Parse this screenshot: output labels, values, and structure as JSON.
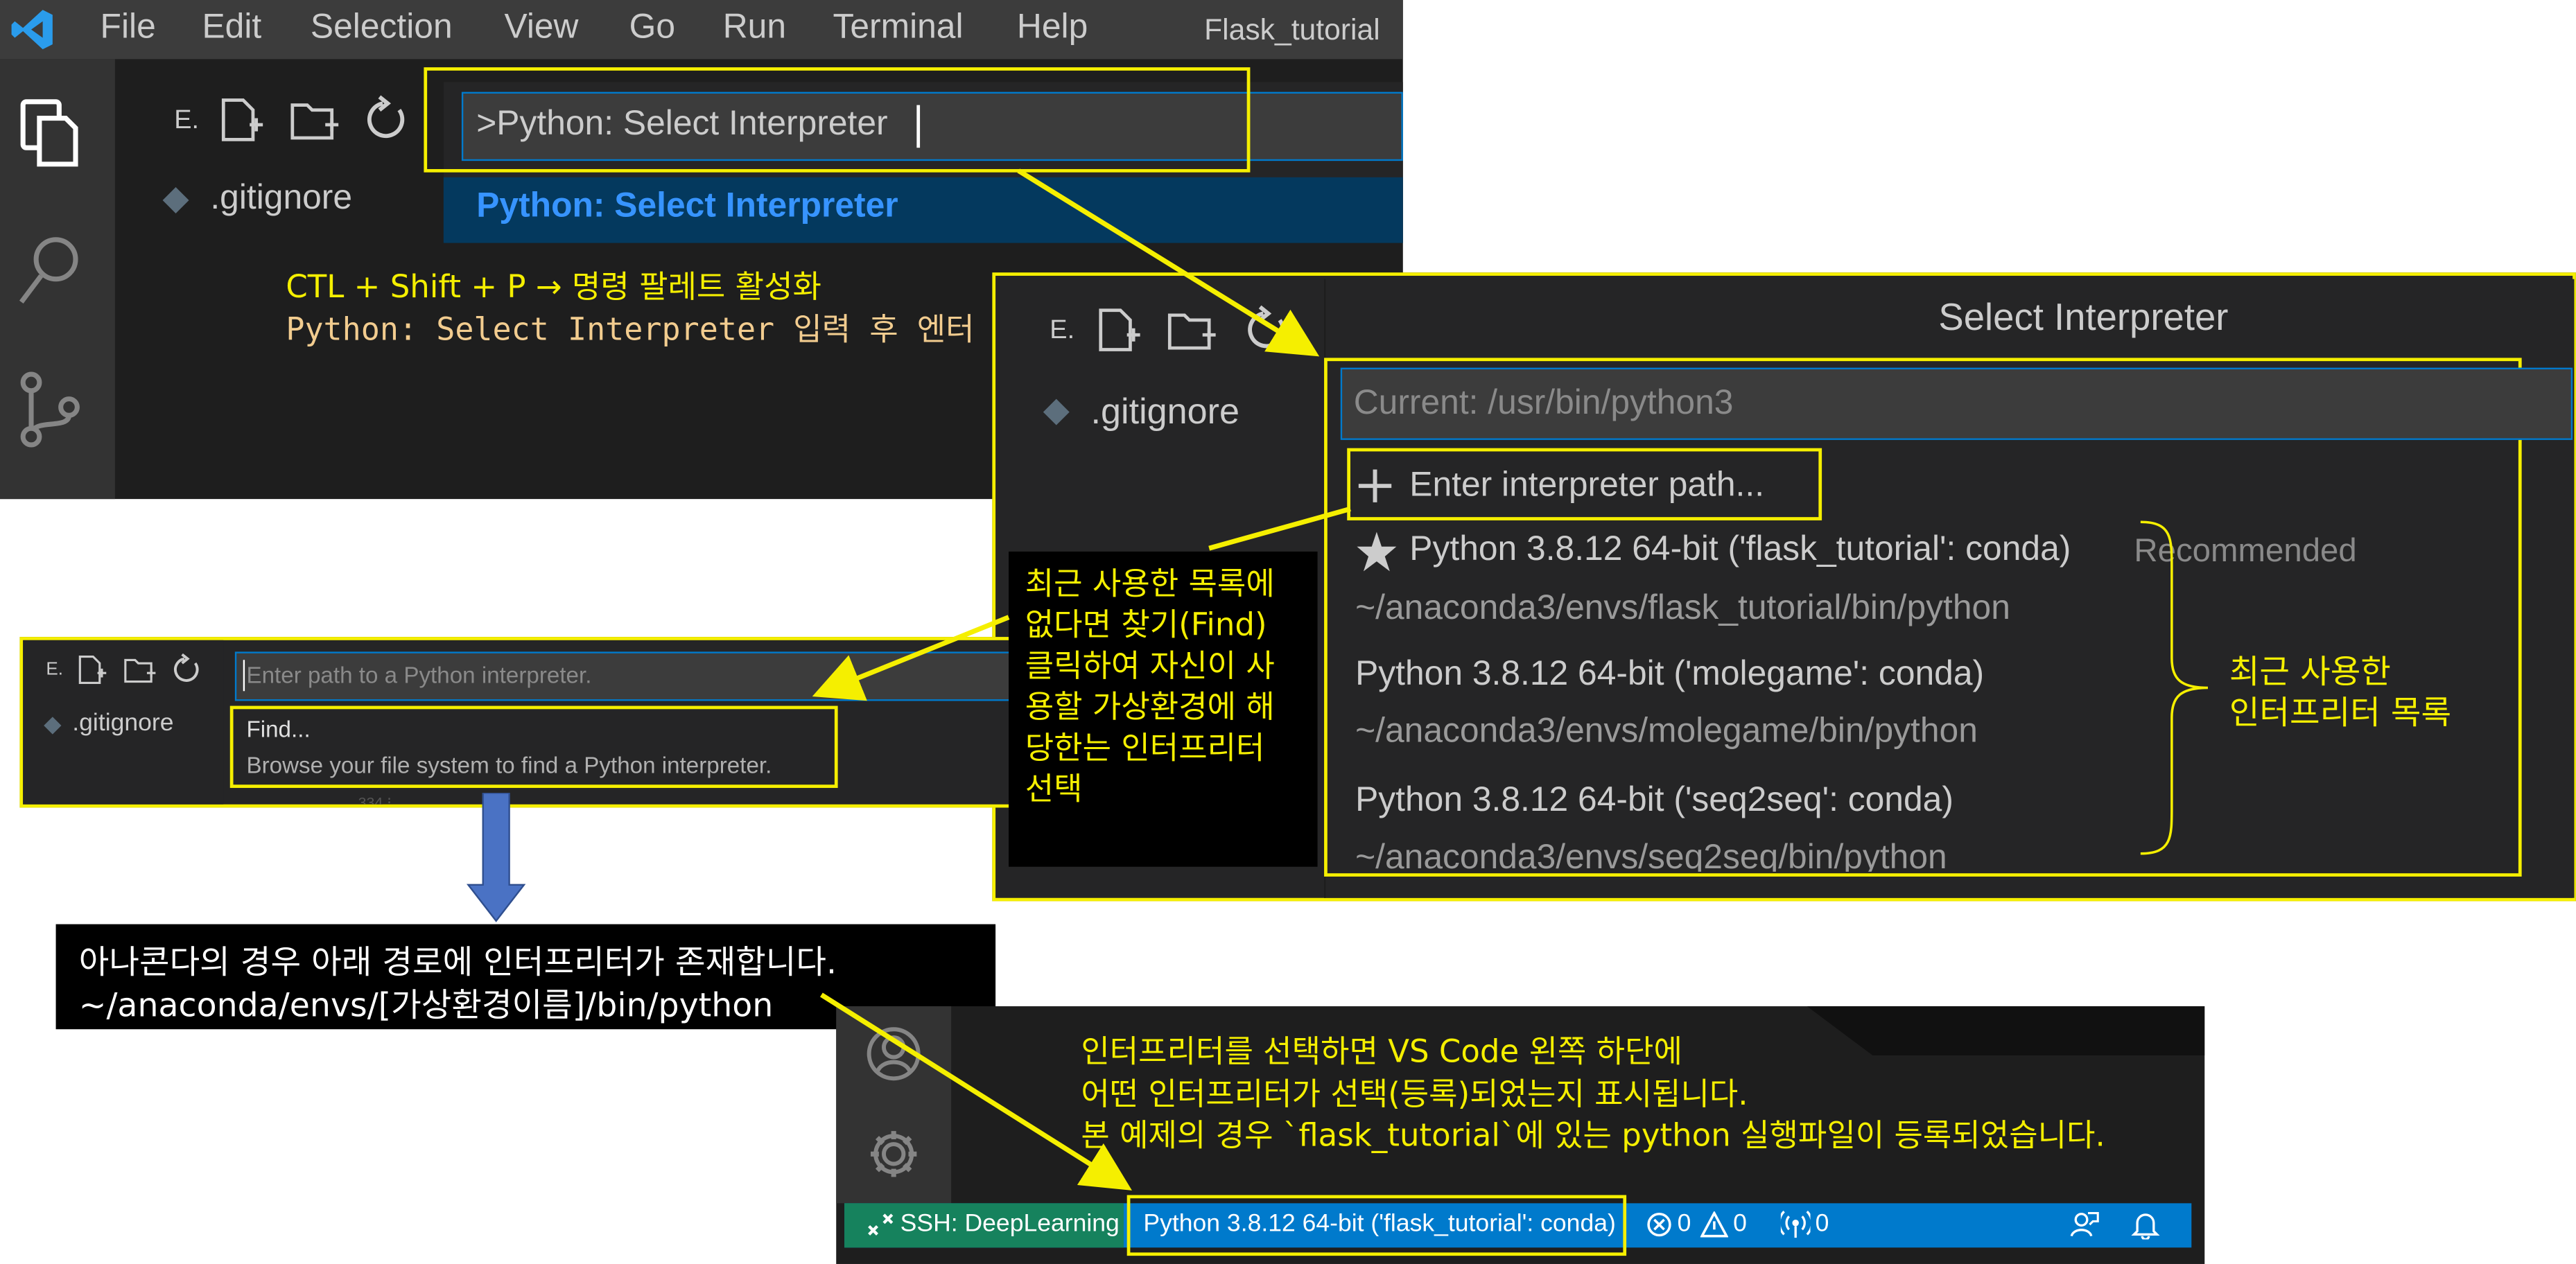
{
  "menubar": {
    "items": [
      "File",
      "Edit",
      "Selection",
      "View",
      "Go",
      "Run",
      "Terminal",
      "Help"
    ],
    "window_title": "Flask_tutorial"
  },
  "explorer": {
    "label": "E.",
    "file": ".gitignore"
  },
  "command_palette": {
    "input_value": ">Python: Select Interpreter",
    "suggestion": "Python: Select Interpreter"
  },
  "note_shortcut": {
    "line1": "CTL + Shift + P → 명령 팔레트 활성화",
    "line2": "Python: Select Interpreter 입력 후 엔터"
  },
  "select_interpreter": {
    "title": "Select Interpreter",
    "placeholder": "Current: /usr/bin/python3",
    "enter_path": "Enter interpreter path...",
    "recommended": "Recommended",
    "interpreters": [
      {
        "name": "Python 3.8.12 64-bit ('flask_tutorial': conda)",
        "path": "~/anaconda3/envs/flask_tutorial/bin/python"
      },
      {
        "name": "Python 3.8.12 64-bit ('molegame': conda)",
        "path": "~/anaconda3/envs/molegame/bin/python"
      },
      {
        "name": "Python 3.8.12 64-bit ('seq2seq': conda)",
        "path": "~/anaconda3/envs/seq2seq/bin/python"
      }
    ],
    "brace_label_line1": "최근 사용한",
    "brace_label_line2": "인터프리터 목록"
  },
  "path_input": {
    "placeholder": "Enter path to a Python interpreter.",
    "find_title": "Find...",
    "find_desc": "Browse your file system to find a Python interpreter.",
    "faded_text": "334 ⁝ ..."
  },
  "find_note": {
    "text": "최근 사용한 목록에 없다면 찾기(Find) 클릭하여 자신이 사용할 가상환경에 해당한는 인터프리터 선택"
  },
  "anaconda_note": {
    "line1": "아나콘다의 경우 아래 경로에 인터프리터가 존재합니다.",
    "line2": "~/anaconda/envs/[가상환경이름]/bin/python"
  },
  "statusbar_note": {
    "line1": "인터프리터를 선택하면 VS Code 왼쪽 하단에",
    "line2": "어떤 인터프리터가 선택(등록)되었는지 표시됩니다.",
    "line3": "본 예제의 경우 `flask_tutorial`에 있는 python 실행파일이 등록되었습니다."
  },
  "statusbar": {
    "remote": "SSH: DeepLearning",
    "interpreter": "Python 3.8.12 64-bit ('flask_tutorial': conda)",
    "errors": "0",
    "warnings": "0",
    "ports": "0"
  },
  "colors": {
    "annotation_yellow": "#f5ef00",
    "vscode_blue": "#007acc",
    "remote_green": "#16825d",
    "arrow_blue": "#4a72c4",
    "editor_bg": "#1e1e1e",
    "sidebar_bg": "#252526",
    "activitybar_bg": "#333333"
  }
}
